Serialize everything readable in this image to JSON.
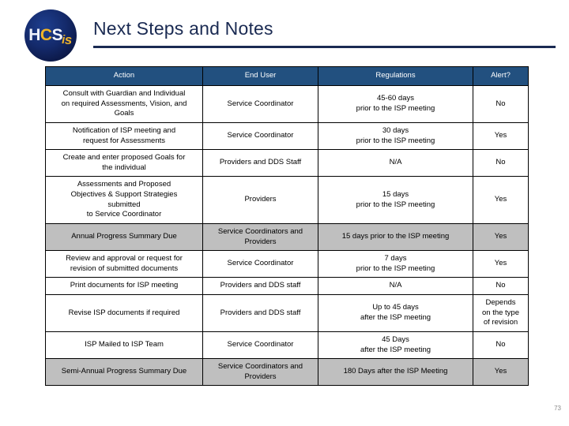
{
  "slide": {
    "title": "Next Steps and Notes",
    "page_number": "73",
    "accent_color": "#1a2a52",
    "header_fill": "#22507f",
    "shaded_row_fill": "#bfbfbf"
  },
  "logo": {
    "name": "hcsis-logo",
    "part_h": "H",
    "part_c": "C",
    "part_s": "S",
    "part_i": "i",
    "part_s2": "s"
  },
  "table": {
    "columns": [
      {
        "label": "Action"
      },
      {
        "label": "End User"
      },
      {
        "label": "Regulations"
      },
      {
        "label": "Alert?"
      }
    ],
    "rows": [
      {
        "shaded": false,
        "action": [
          "Consult with Guardian and Individual",
          "on required Assessments, Vision, and",
          "Goals"
        ],
        "end_user": [
          "Service Coordinator"
        ],
        "regulations": [
          "45-60 days",
          "prior to the ISP meeting"
        ],
        "alert": [
          "No"
        ]
      },
      {
        "shaded": false,
        "action": [
          "Notification of ISP meeting and",
          "request for Assessments"
        ],
        "end_user": [
          "Service Coordinator"
        ],
        "regulations": [
          "30 days",
          "prior to the ISP meeting"
        ],
        "alert": [
          "Yes"
        ]
      },
      {
        "shaded": false,
        "action": [
          "Create and enter proposed Goals for",
          "the individual"
        ],
        "end_user": [
          "Providers and DDS Staff"
        ],
        "regulations": [
          "N/A"
        ],
        "alert": [
          "No"
        ]
      },
      {
        "shaded": false,
        "action": [
          "Assessments and Proposed",
          "Objectives & Support Strategies",
          "submitted",
          "to Service Coordinator"
        ],
        "end_user": [
          "Providers"
        ],
        "regulations": [
          "15 days",
          "prior to the ISP meeting"
        ],
        "alert": [
          "Yes"
        ]
      },
      {
        "shaded": true,
        "action": [
          "Annual Progress Summary Due"
        ],
        "end_user": [
          "Service Coordinators and",
          "Providers"
        ],
        "regulations": [
          "15 days prior to the ISP meeting"
        ],
        "alert": [
          "Yes"
        ]
      },
      {
        "shaded": false,
        "action": [
          "Review and approval or request for",
          "revision of submitted documents"
        ],
        "end_user": [
          "Service Coordinator"
        ],
        "regulations": [
          "7 days",
          "prior to the ISP meeting"
        ],
        "alert": [
          "Yes"
        ]
      },
      {
        "shaded": false,
        "action": [
          "Print documents for ISP meeting"
        ],
        "end_user": [
          "Providers and DDS staff"
        ],
        "regulations": [
          "N/A"
        ],
        "alert": [
          "No"
        ]
      },
      {
        "shaded": false,
        "action": [
          "Revise ISP documents if required"
        ],
        "end_user": [
          "Providers and DDS staff"
        ],
        "regulations": [
          "Up to 45 days",
          "after the ISP meeting"
        ],
        "alert": [
          "Depends",
          "on the type",
          "of revision"
        ]
      },
      {
        "shaded": false,
        "action": [
          "ISP Mailed to ISP Team"
        ],
        "end_user": [
          "Service Coordinator"
        ],
        "regulations": [
          "45 Days",
          "after the ISP meeting"
        ],
        "alert": [
          "No"
        ]
      },
      {
        "shaded": true,
        "action": [
          "Semi-Annual Progress Summary Due"
        ],
        "end_user": [
          "Service Coordinators and",
          "Providers"
        ],
        "regulations": [
          "180 Days after the ISP Meeting"
        ],
        "alert": [
          "Yes"
        ]
      }
    ]
  }
}
